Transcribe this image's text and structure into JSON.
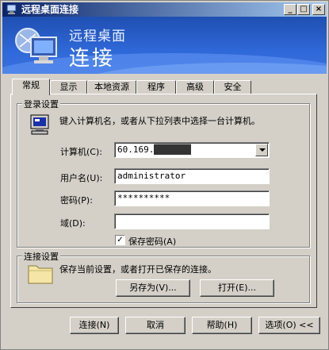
{
  "window": {
    "title": "远程桌面连接",
    "controls": {
      "minimize": "_",
      "maximize": "□",
      "close": "×"
    }
  },
  "banner": {
    "line1": "远程桌面",
    "line2": "连接"
  },
  "tabs": [
    {
      "label": "常规",
      "active": true
    },
    {
      "label": "显示"
    },
    {
      "label": "本地资源"
    },
    {
      "label": "程序"
    },
    {
      "label": "高级"
    },
    {
      "label": "安全"
    }
  ],
  "login": {
    "group_label": "登录设置",
    "instruction": "键入计算机名，或者从下拉列表中选择一台计算机。",
    "computer_label": "计算机(C):",
    "computer_value": "60.169.",
    "username_label": "用户名(U):",
    "username_value": "administrator",
    "password_label": "密码(P):",
    "password_value": "**********",
    "domain_label": "域(D):",
    "domain_value": "",
    "save_password_label": "保存密码(A)",
    "save_password_checked": "✓"
  },
  "connection": {
    "group_label": "连接设置",
    "instruction": "保存当前设置，或者打开已保存的连接。",
    "save_as_label": "另存为(V)...",
    "open_label": "打开(E)..."
  },
  "footer": {
    "connect_label": "连接(N)",
    "cancel_label": "取消",
    "help_label": "帮助(H)",
    "options_label": "选项(O) <<"
  }
}
